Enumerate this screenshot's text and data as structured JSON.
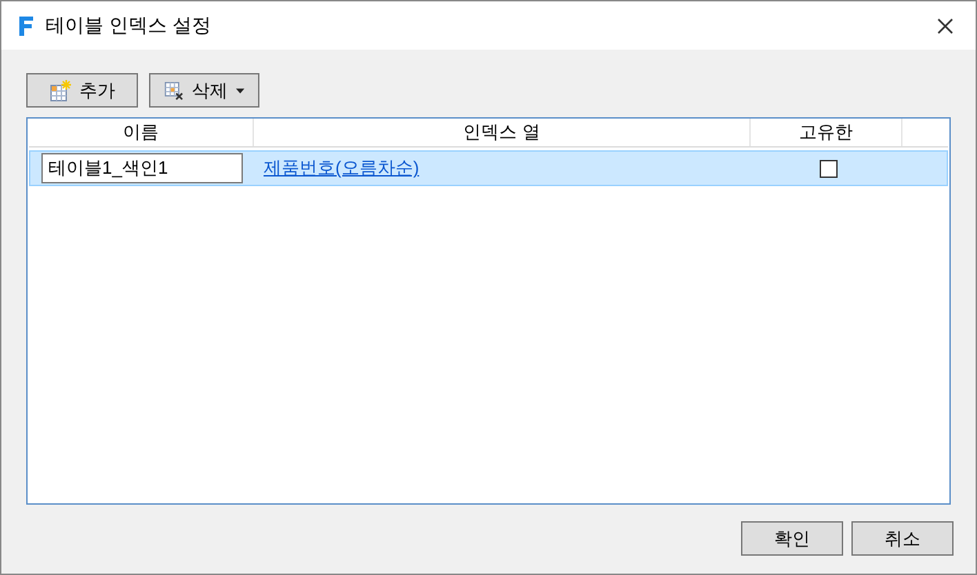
{
  "window": {
    "title": "테이블 인덱스 설정"
  },
  "toolbar": [
    {
      "label": "추가",
      "kind": "add"
    },
    {
      "label": "삭제",
      "kind": "delete"
    }
  ],
  "table": {
    "columns": [
      "이름",
      "인덱스 열",
      "고유한"
    ],
    "rows": [
      {
        "name": "테이블1_색인1",
        "index_column": "제품번호(오름차순)",
        "unique": false,
        "selected": true
      }
    ]
  },
  "buttons": [
    "확인",
    "취소"
  ]
}
